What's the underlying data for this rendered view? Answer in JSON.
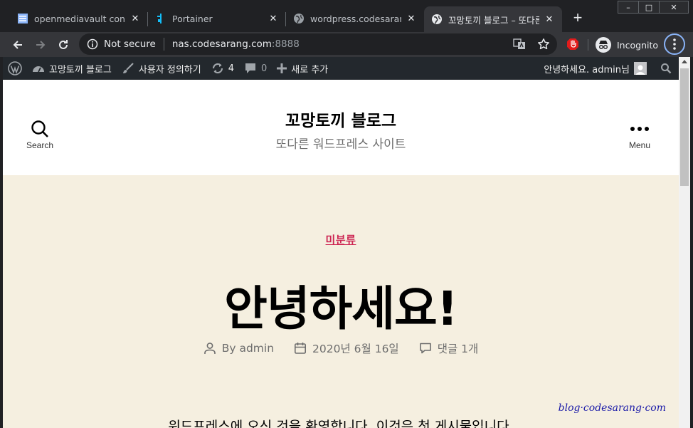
{
  "tabs": [
    {
      "title": "openmediavault control",
      "active": false
    },
    {
      "title": "Portainer",
      "active": false
    },
    {
      "title": "wordpress.codesarang.c",
      "active": false
    },
    {
      "title": "꼬망토끼 블로그 – 또다른",
      "active": true
    }
  ],
  "omnibox": {
    "security": "Not secure",
    "host": "nas.codesarang.com",
    "port": ":8888"
  },
  "profile": {
    "label": "Incognito"
  },
  "adminbar": {
    "site_name": "꼬망토끼 블로그",
    "customize": "사용자 정의하기",
    "updates_count": "4",
    "comments_count": "0",
    "new_label": "새로 추가",
    "howdy": "안녕하세요. admin님"
  },
  "site": {
    "title": "꼬망토끼 블로그",
    "description": "또다른 워드프레스 사이트",
    "search_label": "Search",
    "menu_label": "Menu"
  },
  "post": {
    "category": "미분류",
    "title": "안녕하세요!",
    "author": "By admin",
    "date": "2020년 6월 16일",
    "comments": "댓글 1개",
    "content_start": "워드프레스에 오신 것을 환영합니다. 이것은 첫 게시물입니다."
  },
  "watermark": "blog·codesarang·com"
}
